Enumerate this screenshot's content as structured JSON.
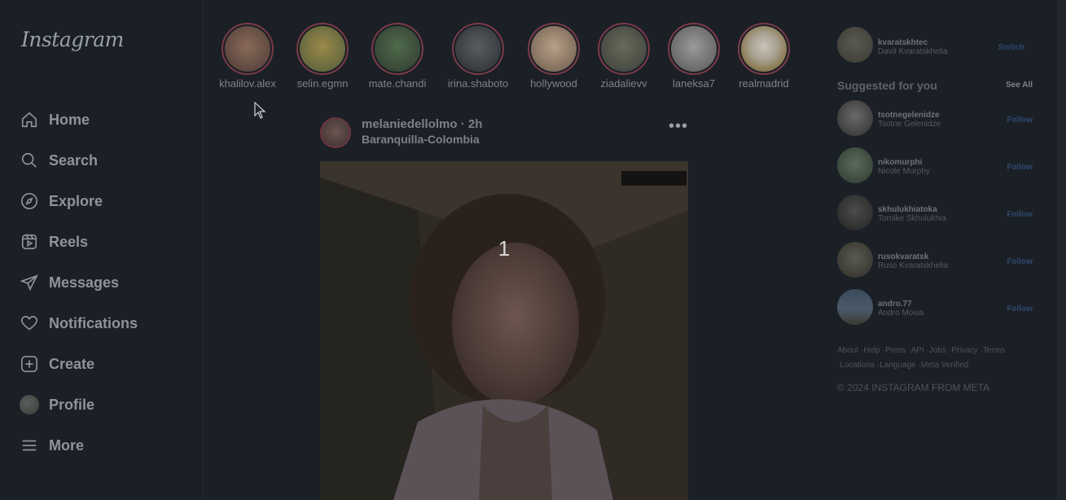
{
  "app": {
    "logo": "Instagram"
  },
  "sidebar": {
    "items": [
      {
        "label": "Home",
        "icon": "home-icon"
      },
      {
        "label": "Search",
        "icon": "search-icon"
      },
      {
        "label": "Explore",
        "icon": "compass-icon"
      },
      {
        "label": "Reels",
        "icon": "reels-icon"
      },
      {
        "label": "Messages",
        "icon": "send-icon"
      },
      {
        "label": "Notifications",
        "icon": "heart-icon"
      },
      {
        "label": "Create",
        "icon": "plus-square-icon"
      },
      {
        "label": "Profile",
        "icon": "avatar"
      },
      {
        "label": "More",
        "icon": "menu-icon"
      }
    ]
  },
  "stories": [
    {
      "name": "khalilov.alex"
    },
    {
      "name": "selin.egmn"
    },
    {
      "name": "mate.chandi"
    },
    {
      "name": "irina.shaboto"
    },
    {
      "name": "hollywood"
    },
    {
      "name": "ziadalievv"
    },
    {
      "name": "laneksa7"
    },
    {
      "name": "realmadrid"
    }
  ],
  "post": {
    "user_time": "melaniedellolmo · 2h",
    "location": "Baranquilla-Colombia",
    "more": "•••",
    "counter": "1"
  },
  "right": {
    "me": {
      "username": "kvaratskhtec",
      "fullname": "Davit Kvaratskhelia",
      "action": "Switch"
    },
    "suggested_title": "Suggested for you",
    "see_all": "See All",
    "suggestions": [
      {
        "username": "tsotnegelenidze",
        "fullname": "Tsotne Gelenidze",
        "action": "Follow"
      },
      {
        "username": "nikomurphi",
        "fullname": "Nicole Murphy",
        "action": "Follow"
      },
      {
        "username": "skhulukhiatoka",
        "fullname": "Tornike Skhulukhia",
        "action": "Follow"
      },
      {
        "username": "rusokvaratsk",
        "fullname": "Ruso Kvaratskhelia",
        "action": "Follow"
      },
      {
        "username": "andro.77",
        "fullname": "Andro Mosia",
        "action": "Follow"
      }
    ],
    "footer_line1": [
      "About",
      "·Help",
      "·Press",
      "·API",
      "·Jobs",
      "·Privacy",
      "·Terms"
    ],
    "footer_line2": [
      "·Locations",
      "·Language",
      "·Meta Verified"
    ],
    "copyright": "© 2024 INSTAGRAM FROM META"
  }
}
